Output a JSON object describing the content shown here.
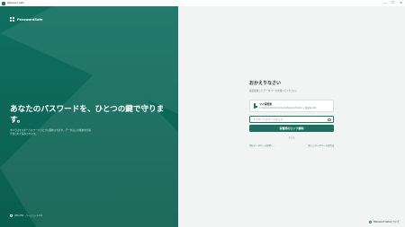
{
  "window": {
    "title": "Password Safe",
    "controls": {
      "minimize": "—",
      "maximize": "☐",
      "close": "✕"
    }
  },
  "left_panel": {
    "brand_name": "PasswordSafe",
    "headline": "あなたのパスワードを、ひとつの鍵で守ります。",
    "subtext": "すべてはマスターパスワードひとつに集約されます。データはこの端末内で暗号化されて保存されます。",
    "footer_version": "AES-256 · バージョン 1.0.0"
  },
  "form": {
    "heading": "おかえりなさい",
    "subheading": "最近使用したデータベースを開いてください。",
    "vault": {
      "name": "マイ保管庫",
      "path": "C:\\Users\\Admin\\Documents\\PasswordSafe\\マイ保管庫.psdb"
    },
    "password_placeholder": "マスターパスワードを入力",
    "unlock_label": "保管庫のロック解除",
    "or_label": "または",
    "link_open": "別のデータベースを開く…",
    "link_new": "新しいデータベースを作成"
  },
  "restore": {
    "label": "Password Safeについて"
  },
  "colors": {
    "brand_green": "#10705f",
    "accent": "#1f6f5f",
    "panel_bg": "#f2f4f3"
  },
  "icons": {
    "app": "app-logo-icon",
    "brand": "grid-logo-icon",
    "vault": "document-icon",
    "eye": "eye-icon",
    "shield": "shield-icon",
    "info": "info-icon"
  }
}
